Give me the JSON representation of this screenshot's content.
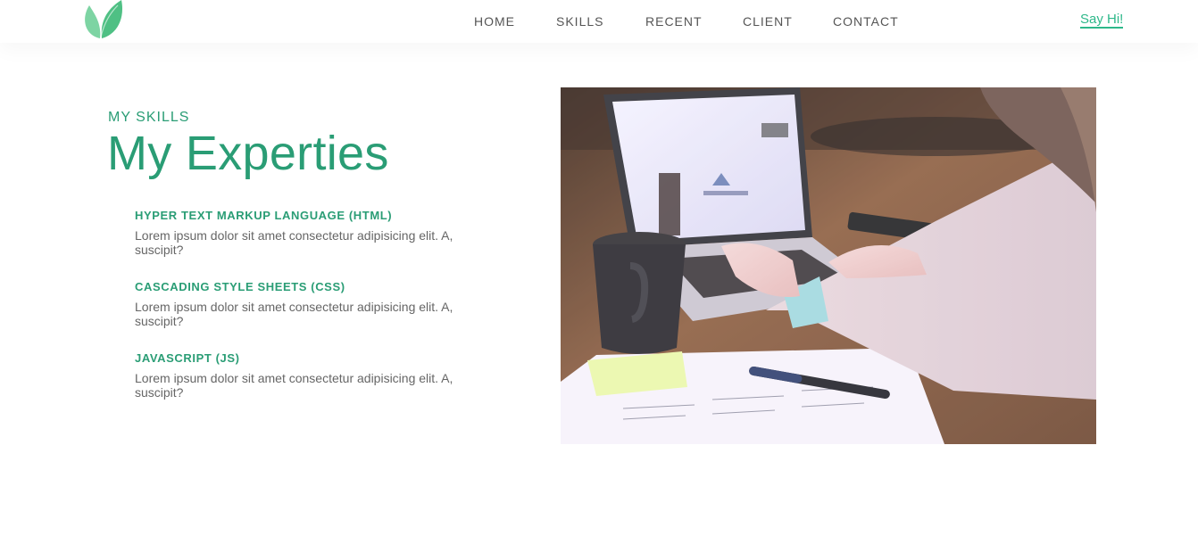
{
  "header": {
    "logo_icon": "leaf-logo-icon",
    "nav": [
      "HOME",
      "SKILLS",
      "RECENT",
      "CLIENT",
      "CONTACT"
    ],
    "cta": "Say Hi!"
  },
  "hero": {
    "eyebrow": "MY SKILLS",
    "title": "My Experties",
    "skills": [
      {
        "title": "HYPER TEXT MARKUP LANGUAGE (HTML)",
        "desc": "Lorem ipsum dolor sit amet consectetur adipisicing elit. A, suscipit?"
      },
      {
        "title": "CASCADING STYLE SHEETS (CSS)",
        "desc": "Lorem ipsum dolor sit amet consectetur adipisicing elit. A, suscipit?"
      },
      {
        "title": "JAVASCRIPT (JS)",
        "desc": "Lorem ipsum dolor sit amet consectetur adipisicing elit. A, suscipit?"
      }
    ]
  },
  "photo": {
    "subject": "person-typing-on-laptop-photo"
  },
  "colors": {
    "accent": "#2a9d75",
    "link": "#2eb88a",
    "nav_text": "#555555",
    "body_text": "#666666"
  }
}
